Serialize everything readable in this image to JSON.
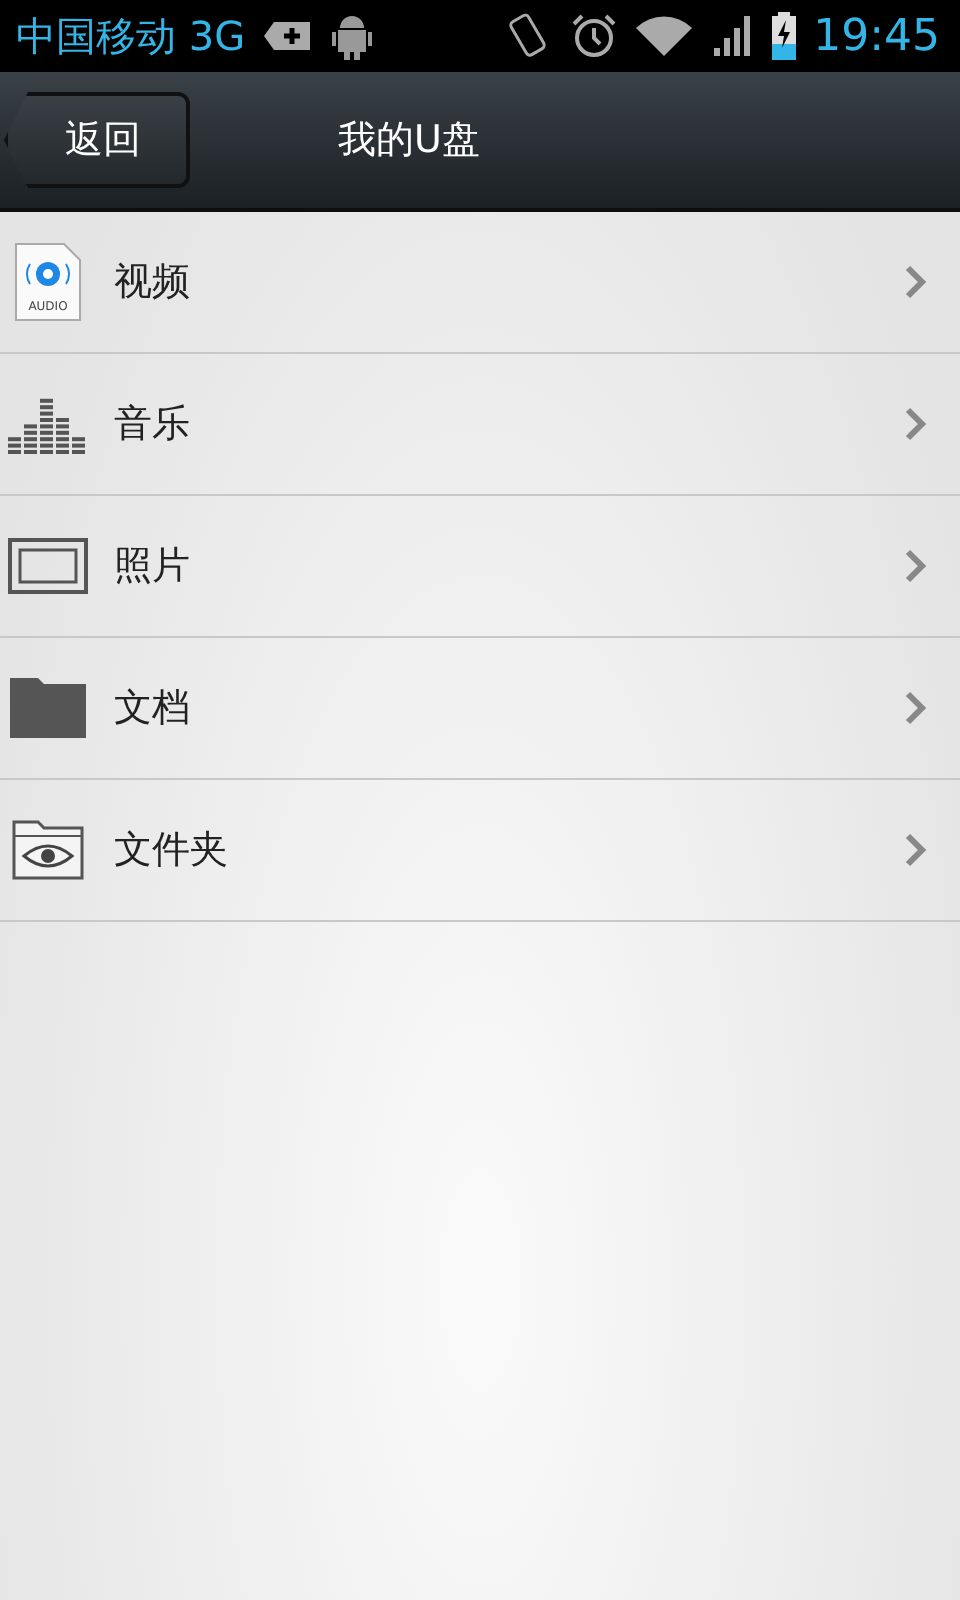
{
  "status_bar": {
    "carrier": "中国移动 3G",
    "time": "19:45"
  },
  "header": {
    "back": "返回",
    "title": "我的U盘"
  },
  "items": [
    {
      "label": "视频",
      "kind": "audio",
      "icon_text": "AUDIO"
    },
    {
      "label": "音乐",
      "kind": "equalizer"
    },
    {
      "label": "照片",
      "kind": "frame"
    },
    {
      "label": "文档",
      "kind": "folder"
    },
    {
      "label": "文件夹",
      "kind": "eye-folder"
    }
  ]
}
